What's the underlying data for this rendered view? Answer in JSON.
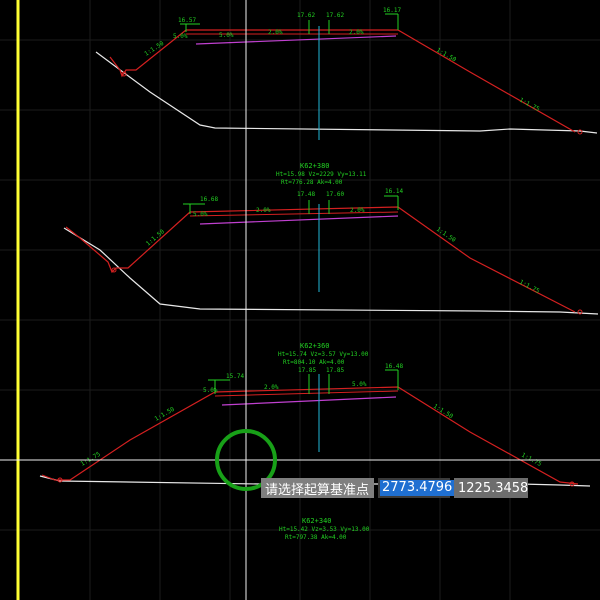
{
  "command": {
    "prompt": "请选择起算基准点",
    "x_value": "2773.4796",
    "y_value": "1225.3458"
  },
  "sections": [
    {
      "labels": {
        "l1": "1:1.50",
        "l2": "1:1.75",
        "l3": "1:1.50",
        "l4": "1:1.75",
        "w1": "16.57",
        "w2": "17.62",
        "w3": "17.62",
        "w4": "16.17",
        "s1": "5.0%",
        "s2": "5.0%",
        "s3": "2.0%",
        "s4": "2.0%"
      }
    },
    {
      "station": "K62+380",
      "info1": "Ht=15.98 Vz=2229 Vy=13.11",
      "info2": "Rt=776.28 Ak=4.00",
      "labels": {
        "l1": "1:1.50",
        "l3": "1:1.50",
        "l4": "1:1.75",
        "w1": "16.68",
        "w2": "17.48",
        "w3": "17.60",
        "w4": "16.14",
        "s1": "5.0%",
        "s2": "2.0%",
        "s3": "2.0%"
      }
    },
    {
      "station": "K62+360",
      "info1": "Ht=15.74 Vz=3.57 Vy=13.00",
      "info2": "Rt=804.10 Ak=4.00",
      "labels": {
        "l1": "1:1.50",
        "l2": "1:1.75",
        "l3": "1:1.50",
        "l4": "1:1.75",
        "w1": "15.74",
        "w2": "17.85",
        "w3": "17.85",
        "w4": "16.48",
        "s1": "5.0%",
        "s2": "2.0%",
        "s3": "5.0%"
      }
    },
    {
      "station": "K62+340",
      "info1": "Ht=15.42 Vz=3.53 Vy=13.00",
      "info2": "Rt=797.38 Ak=4.00"
    }
  ]
}
